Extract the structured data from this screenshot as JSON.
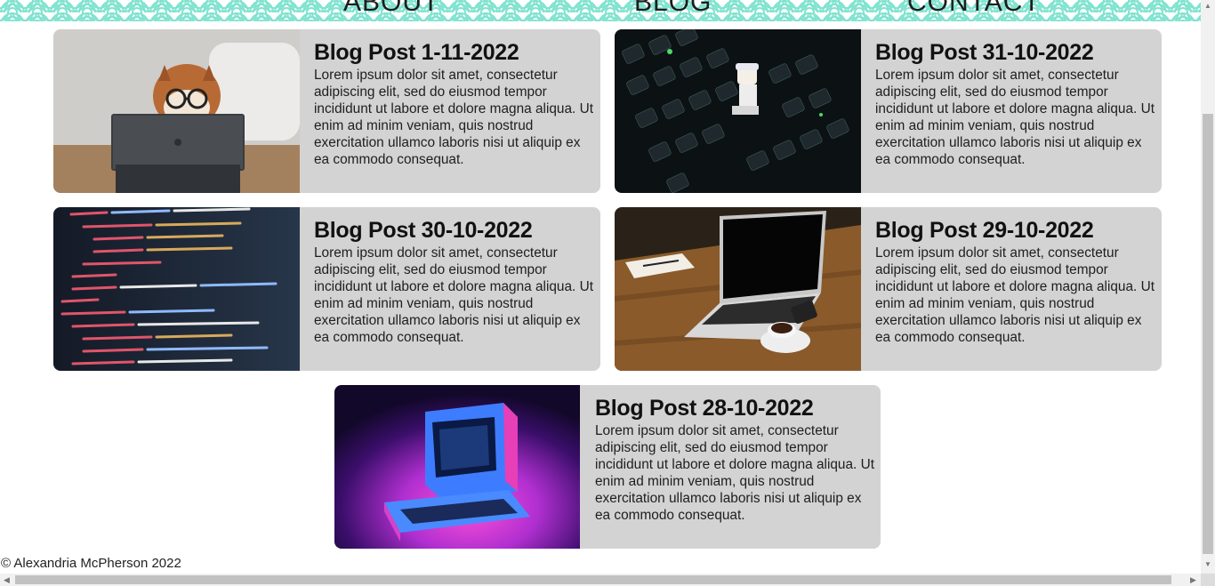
{
  "nav": {
    "about": "ABOUT",
    "blog": "BLOG",
    "contact": "CONTACT"
  },
  "colors": {
    "wave": "#7fe3cf",
    "card_bg": "#d3d3d3"
  },
  "posts": [
    {
      "title": "Blog Post 1-11-2022",
      "text": "Lorem ipsum dolor sit amet, consectetur adipiscing elit, sed do eiusmod tempor incididunt ut labore et dolore magna aliqua. Ut enim ad minim veniam, quis nostrud exercitation ullamco laboris nisi ut aliquip ex ea commodo consequat.",
      "image": "dog-with-glasses-tablet-image"
    },
    {
      "title": "Blog Post 31-10-2022",
      "text": "Lorem ipsum dolor sit amet, consectetur adipiscing elit, sed do eiusmod tempor incididunt ut labore et dolore magna aliqua. Ut enim ad minim veniam, quis nostrud exercitation ullamco laboris nisi ut aliquip ex ea commodo consequat.",
      "image": "keyboard-minifigure-image"
    },
    {
      "title": "Blog Post 30-10-2022",
      "text": "Lorem ipsum dolor sit amet, consectetur adipiscing elit, sed do eiusmod tempor incididunt ut labore et dolore magna aliqua. Ut enim ad minim veniam, quis nostrud exercitation ullamco laboris nisi ut aliquip ex ea commodo consequat.",
      "image": "code-screen-image"
    },
    {
      "title": "Blog Post 29-10-2022",
      "text": "Lorem ipsum dolor sit amet, consectetur adipiscing elit, sed do eiusmod tempor incididunt ut labore et dolore magna aliqua. Ut enim ad minim veniam, quis nostrud exercitation ullamco laboris nisi ut aliquip ex ea commodo consequat.",
      "image": "laptop-on-desk-image"
    },
    {
      "title": "Blog Post 28-10-2022",
      "text": "Lorem ipsum dolor sit amet, consectetur adipiscing elit, sed do eiusmod tempor incididunt ut labore et dolore magna aliqua. Ut enim ad minim veniam, quis nostrud exercitation ullamco laboris nisi ut aliquip ex ea commodo consequat.",
      "image": "retro-computer-neon-image"
    }
  ],
  "footer": {
    "copyright": "© Alexandria McPherson 2022"
  }
}
